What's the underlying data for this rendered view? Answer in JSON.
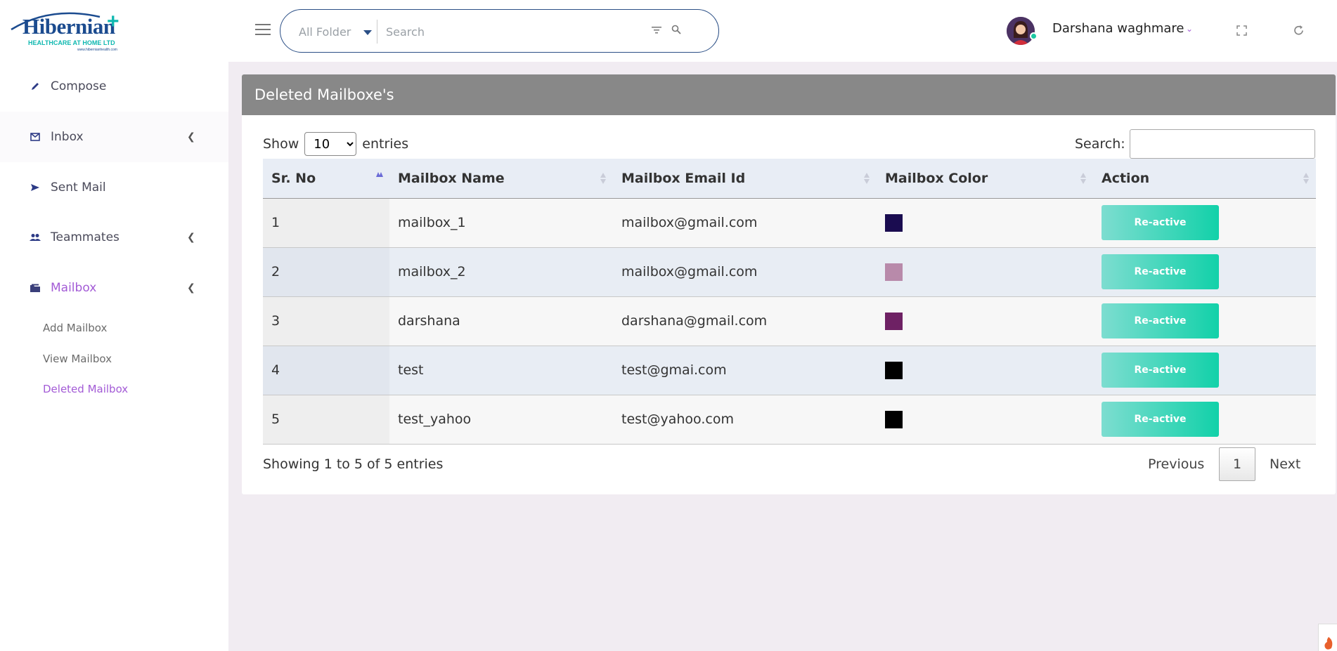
{
  "brand": {
    "logo_name": "Hibernian",
    "logo_tagline": "HEALTHCARE AT HOME LTD",
    "logo_url": "www.hibernianhealth.com"
  },
  "sidebar": {
    "items": [
      {
        "label": "Compose",
        "icon": "pencil-icon"
      },
      {
        "label": "Inbox",
        "icon": "envelope-icon"
      },
      {
        "label": "Sent Mail",
        "icon": "send-icon"
      },
      {
        "label": "Teammates",
        "icon": "users-icon"
      },
      {
        "label": "Mailbox",
        "icon": "folder-icon"
      }
    ],
    "mailbox_sub": [
      {
        "label": "Add Mailbox"
      },
      {
        "label": "View Mailbox"
      },
      {
        "label": "Deleted Mailbox"
      }
    ]
  },
  "topbar": {
    "folder_select": "All Folder",
    "search_placeholder": "Search",
    "user_name": "Darshana waghmare"
  },
  "card": {
    "title": "Deleted Mailboxe's",
    "show_label": "Show",
    "entries_label": "entries",
    "page_size": "10",
    "search_label": "Search:",
    "columns": [
      "Sr. No",
      "Mailbox Name",
      "Mailbox Email Id",
      "Mailbox Color",
      "Action"
    ],
    "rows": [
      {
        "sr": "1",
        "name": "mailbox_1",
        "email": "mailbox@gmail.com",
        "color": "#1a0c50",
        "action": "Re-active"
      },
      {
        "sr": "2",
        "name": "mailbox_2",
        "email": "mailbox@gmail.com",
        "color": "#b88aaa",
        "action": "Re-active"
      },
      {
        "sr": "3",
        "name": "darshana",
        "email": "darshana@gmail.com",
        "color": "#6e2164",
        "action": "Re-active"
      },
      {
        "sr": "4",
        "name": "test",
        "email": "test@gmai.com",
        "color": "#000000",
        "action": "Re-active"
      },
      {
        "sr": "5",
        "name": "test_yahoo",
        "email": "test@yahoo.com",
        "color": "#000000",
        "action": "Re-active"
      }
    ],
    "info": "Showing 1 to 5 of 5 entries",
    "pager": {
      "prev": "Previous",
      "page": "1",
      "next": "Next"
    }
  },
  "colors": {
    "accent": "#a35bd6",
    "header_bg": "#888888",
    "button_start": "#7dddd0",
    "button_end": "#12d1a9"
  }
}
